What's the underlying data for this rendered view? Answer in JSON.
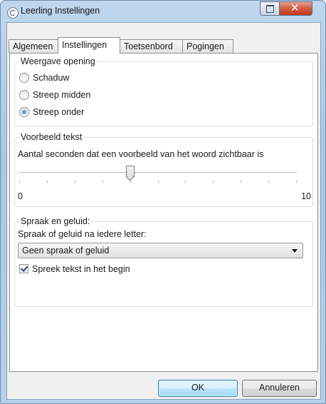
{
  "window": {
    "title": "Leerling Instellingen"
  },
  "tabs": [
    {
      "label": "Algemeen"
    },
    {
      "label": "Instellingen"
    },
    {
      "label": "Toetsenbord"
    },
    {
      "label": "Pogingen"
    }
  ],
  "weergave": {
    "legend": "Weergave opening",
    "options": [
      {
        "label": "Schaduw",
        "selected": false
      },
      {
        "label": "Streep midden",
        "selected": false
      },
      {
        "label": "Streep onder",
        "selected": true
      }
    ]
  },
  "voorbeeld": {
    "legend": "Voorbeeld tekst",
    "description": "Aantal seconden dat een voorbeeld van het woord zichtbaar is",
    "slider": {
      "min_label": "0",
      "max_label": "10",
      "min": 0,
      "max": 10,
      "value": 4
    }
  },
  "spraak": {
    "legend": "Spraak en geluid:",
    "label": "Spraak of geluid na iedere letter:",
    "select_value": "Geen spraak of geluid",
    "checkbox_label": "Spreek tekst in het begin",
    "checkbox_checked": true
  },
  "buttons": {
    "ok": "OK",
    "cancel": "Annuleren"
  }
}
